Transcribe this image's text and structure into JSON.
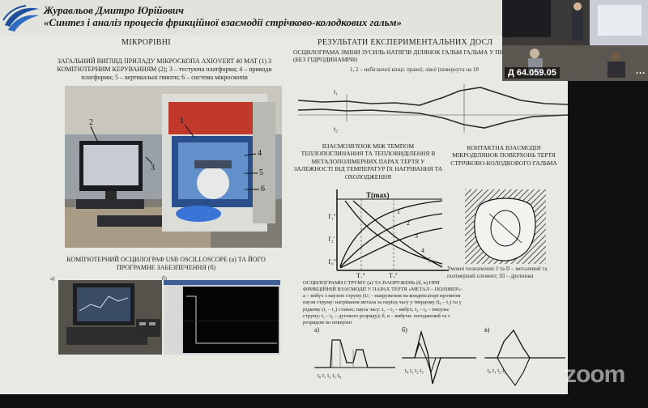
{
  "slide": {
    "author": "Журавльов Дмитро Юрійович",
    "thesis": "«Синтез і аналіз процесів фрикційної взаємодії стрічково-колодкових гальм»",
    "left": {
      "heading": "МІКРОРІВНІ",
      "photo_caption_1": "ЗАГАЛЬНИЙ ВИГЛЯД ПРИЛАДУ МІКРОСКОПА AXIOVERT 40 MAT (1) З КОМП'ЮТЕРНИМ КЕРУВАННЯМ (2); 3 – тестуюча платформа; 4 – приводи платформи; 5 – вертикальні гвинти; 6 – система мікроскопів",
      "photo_labels": [
        "1",
        "2",
        "3",
        "4",
        "5",
        "6"
      ],
      "osc_caption": "КОМП'ЮТЕРНИЙ ОСЦИЛОГРАФ USB OSCILLOSCOPE (а) ТА ЙОГО ПРОГРАМНЕ ЗАБЕЗПЕЧЕННЯ (б)",
      "sub_a": "а)",
      "sub_b": "б)"
    },
    "right": {
      "heading": "РЕЗУЛЬТАТИ ЕКСПЕРИМЕНТАЛЬНИХ ДОСЛ",
      "osc_title": "ОСЦИЛОГРАМА ЗМІНИ ЗУСИЛЬ НАТЯГІВ ДІЛЯНОК ГАЛЬМ ГАЛЬМА У ПЕРІОД ГАЛЬМУВАННЯ (БЕЗ ГІДРОДИНАМІЧН",
      "osc_sub": "1, 2 – набігаючої кінці: правої; лівої (повернута на 18",
      "heat_title": "ВЗАЄМОЗВ'ЯЗОК МІЖ ТЕМПОМ ТЕПЛОПОГЛИНАННЯ ТА ТЕПЛОВИДІЛЕННЯ В МЕТАЛОПОЛІМЕРНИХ ПАРАХ ТЕРТЯ У ЗАЛЕЖНОСТІ ВІД ТЕМПЕРАТУР ЇХ НАГРІВАННЯ ТА ОХОЛОДЖЕННЯ",
      "contact_title": "КОНТАКТНА ВЗАЄМОДІЯ МІКРОДІЛЯНОК ПОВЕРХОНЬ ТЕРТЯ СТРІЧКОВО-КОЛОДКОВОГО ГАЛЬМА",
      "contact_legend": "Умовні позначення: І та ІІ – металевий та полімерний елемент; ІІІ – дротинки",
      "heat_tmax": "Т(max)",
      "heat_t1": "Т₁″",
      "heat_t2": "Т₂′",
      "heat_t0": "Т₀″",
      "heat_tx": "Т₁°",
      "heat_tx2": "Т₂″",
      "curve_labels": [
        "1",
        "2",
        "3",
        "4",
        "5"
      ],
      "pulse_title": "ОСЦИЛОГРАМИ СТРУМУ (а) ТА НАПРУЖЕНЬ (б, в) ПРИ ФРИКЦІЙНІЙ ВЗАЄМОДІЇ У ПАРАХ ТЕРТЯ «МЕТАЛ – ПОЛІМЕР»: а – вибух з паузою струму (Uᵢ – напруження на конденсаторі протягом паузи струму: нагрівання метала за період часу у твердому (t₀ – t₁) та у рідкому (t₁ – t₂) станах; пауза часу: t₂ – t₃ – вибух; t₃ – t₄ – імпульс струму; t₅ – t₆ – дугового розряду); б, в – вибухи: погоджений та з розрядом по поверхні",
      "pulse_sub_a": "а)",
      "pulse_sub_b": "б)",
      "pulse_sub_c": "в)",
      "pulse_ticks_a": "t₀   t₁ t₂ t₃     t₄",
      "pulse_ticks_b": "t₀  t₁ t₂ t₃",
      "pulse_ticks_c": "t₀  t₁ t₂ t₃",
      "osc_curve_labels": [
        "t₁",
        "t₂"
      ]
    }
  },
  "video_tile": {
    "participant_name": "Д 64.059.05",
    "more_label": "···"
  },
  "watermark": "zoom",
  "colors": {
    "slide_bg": "#e9e9e4",
    "screen_bg": "#101011",
    "text": "#1a1a1a"
  }
}
